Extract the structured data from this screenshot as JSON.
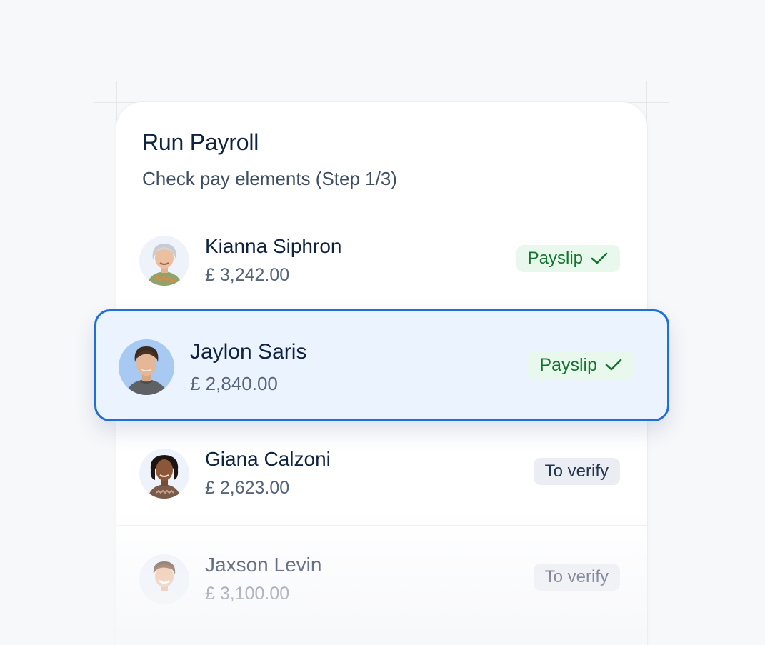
{
  "card": {
    "title": "Run Payroll",
    "subtitle": "Check pay elements (Step 1/3)"
  },
  "employees": [
    {
      "name": "Kianna Siphron",
      "amount": "£ 3,242.00",
      "status": "Payslip",
      "status_icon": "check-icon",
      "selected": false
    },
    {
      "name": "Jaylon Saris",
      "amount": "£ 2,840.00",
      "status": "Payslip",
      "status_icon": "check-icon",
      "selected": true
    },
    {
      "name": "Giana Calzoni",
      "amount": "£ 2,623.00",
      "status": "To verify",
      "status_icon": null,
      "selected": false
    },
    {
      "name": "Jaxson Levin",
      "amount": "£ 3,100.00",
      "status": "To verify",
      "status_icon": null,
      "selected": false
    }
  ],
  "colors": {
    "accent": "#1f6fd6",
    "selected_bg": "#ebf3fe",
    "payslip_bg": "#e8f8ec",
    "payslip_text": "#14742f",
    "verify_bg": "#eaedf2",
    "verify_text": "#23344d"
  }
}
